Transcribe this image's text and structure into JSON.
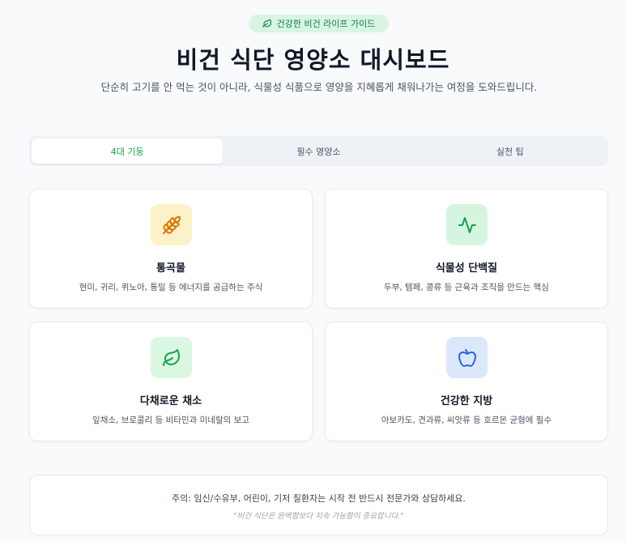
{
  "header": {
    "badge": "건강한 비건 라이프 가이드",
    "title": "비건 식단 영양소 대시보드",
    "subtitle": "단순히 고기를 안 먹는 것이 아니라, 식물성 식품으로 영양을 지혜롭게 채워나가는 여정을 도와드립니다."
  },
  "tabs": [
    {
      "label": "4대 기둥",
      "active": true
    },
    {
      "label": "필수 영양소",
      "active": false
    },
    {
      "label": "실천 팁",
      "active": false
    }
  ],
  "cards": [
    {
      "icon": "wheat-icon",
      "title": "통곡물",
      "desc": "현미, 귀리, 퀴노아, 통밀 등 에너지를 공급하는 주식",
      "color": "#d97706",
      "bg": "#fdf1c8"
    },
    {
      "icon": "activity-icon",
      "title": "식물성 단백질",
      "desc": "두부, 템페, 콩류 등 근육과 조직을 만드는 핵심",
      "color": "#16a34a",
      "bg": "#d6f5e0"
    },
    {
      "icon": "leaf-icon",
      "title": "다채로운 채소",
      "desc": "잎채소, 브로콜리 등 비타민과 미네랄의 보고",
      "color": "#16a34a",
      "bg": "#d9f7e1"
    },
    {
      "icon": "apple-icon",
      "title": "건강한 지방",
      "desc": "아보카도, 견과류, 씨앗류 등 호르몬 균형에 필수",
      "color": "#2563eb",
      "bg": "#dbe7fb"
    }
  ],
  "notice": {
    "text": "주의: 임신/수유부, 어린이, 기저 질환자는 시작 전 반드시 전문가와 상담하세요.",
    "quote": "\"비건 식단은 완벽함보다 지속 가능함이 중요합니다.\""
  }
}
